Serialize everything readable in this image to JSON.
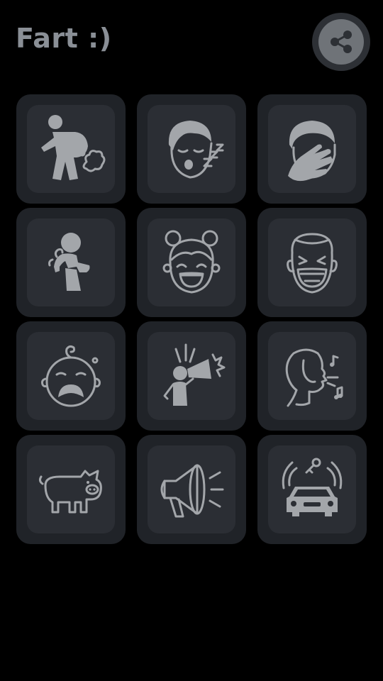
{
  "header": {
    "title": "Fart :)"
  },
  "share": {
    "icon": "share-icon"
  },
  "buttons": [
    {
      "icon": "person-farting-icon"
    },
    {
      "icon": "sleeping-face-icon"
    },
    {
      "icon": "face-palm-icon"
    },
    {
      "icon": "person-coughing-icon"
    },
    {
      "icon": "laughing-girl-icon"
    },
    {
      "icon": "laughing-man-icon"
    },
    {
      "icon": "crying-baby-icon"
    },
    {
      "icon": "person-megaphone-icon"
    },
    {
      "icon": "person-whistling-icon"
    },
    {
      "icon": "pig-icon"
    },
    {
      "icon": "megaphone-icon"
    },
    {
      "icon": "car-alarm-icon"
    }
  ],
  "colors": {
    "background": "#000000",
    "tile": "#202328",
    "tile_inner": "#2b2e34",
    "icon": "#a3a6aa",
    "title": "#8a8f96"
  }
}
